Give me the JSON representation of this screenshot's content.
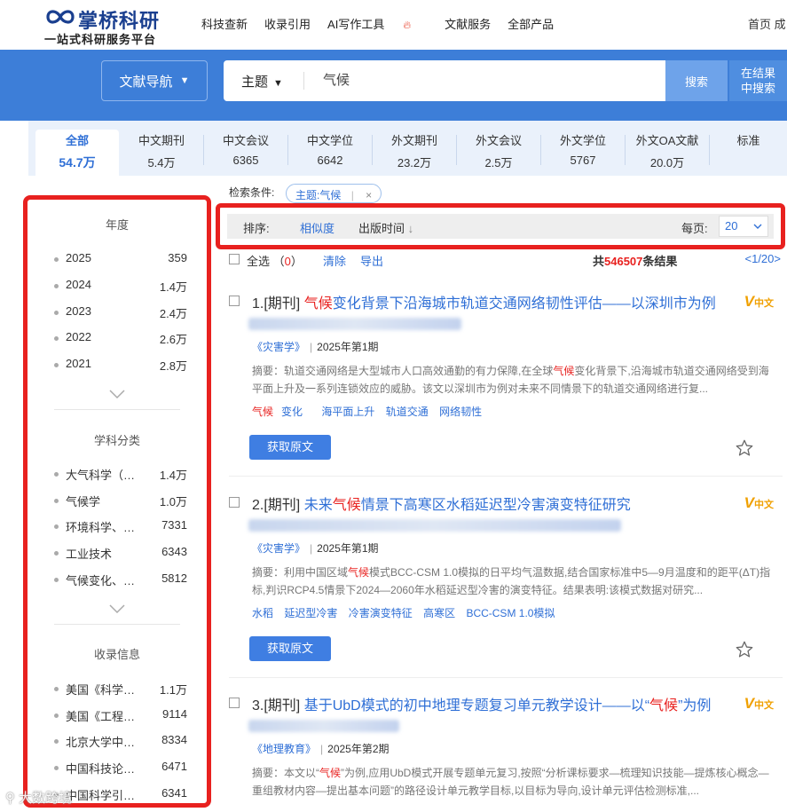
{
  "header": {
    "brand": "掌桥科研",
    "tagline": "一站式科研服务平台",
    "nav": [
      "科技查新",
      "收录引用",
      "AI写作工具",
      "文献服务",
      "全部产品"
    ],
    "right_link": "首页 成"
  },
  "search": {
    "nav_button": "文献导航",
    "field": "主题",
    "query": "气候",
    "search_button": "搜索",
    "in_results_line1": "在结果",
    "in_results_line2": "中搜索"
  },
  "tabs": [
    {
      "label": "全部",
      "count": "54.7万"
    },
    {
      "label": "中文期刊",
      "count": "5.4万"
    },
    {
      "label": "中文会议",
      "count": "6365"
    },
    {
      "label": "中文学位",
      "count": "6642"
    },
    {
      "label": "外文期刊",
      "count": "23.2万"
    },
    {
      "label": "外文会议",
      "count": "2.5万"
    },
    {
      "label": "外文学位",
      "count": "5767"
    },
    {
      "label": "外文OA文献",
      "count": "20.0万"
    },
    {
      "label": "标准",
      "count": ""
    }
  ],
  "sidebar": {
    "year": {
      "title": "年度",
      "items": [
        {
          "name": "2025",
          "count": "359"
        },
        {
          "name": "2024",
          "count": "1.4万"
        },
        {
          "name": "2023",
          "count": "2.4万"
        },
        {
          "name": "2022",
          "count": "2.6万"
        },
        {
          "name": "2021",
          "count": "2.8万"
        }
      ]
    },
    "subject": {
      "title": "学科分类",
      "items": [
        {
          "name": "大气科学（…",
          "count": "1.4万"
        },
        {
          "name": "气候学",
          "count": "1.0万"
        },
        {
          "name": "环境科学、…",
          "count": "7331"
        },
        {
          "name": "工业技术",
          "count": "6343"
        },
        {
          "name": "气候变化、…",
          "count": "5812"
        }
      ]
    },
    "indexing": {
      "title": "收录信息",
      "items": [
        {
          "name": "美国《科学…",
          "count": "1.1万"
        },
        {
          "name": "美国《工程…",
          "count": "9114"
        },
        {
          "name": "北京大学中…",
          "count": "8334"
        },
        {
          "name": "中国科技论…",
          "count": "6471"
        },
        {
          "name": "中国科学引…",
          "count": "6341"
        }
      ]
    }
  },
  "conditions": {
    "label": "检索条件:",
    "chip": "主题:气候",
    "chip_sep": "|",
    "close": "×"
  },
  "sortbar": {
    "label": "排序:",
    "relevance": "相似度",
    "pubtime": "出版时间",
    "arrow": "↓",
    "perpage_label": "每页:",
    "perpage": "20"
  },
  "selection": {
    "select_all": "全选",
    "selected_open": "（",
    "selected": "0",
    "selected_close": "）",
    "clear": "清除",
    "export": "导出",
    "total_prefix": "共",
    "total": "546507",
    "total_suffix": "条结果",
    "pages": "<1/20>"
  },
  "results": [
    {
      "idx": "1.[期刊]",
      "title_hl": "气候",
      "title_rest": "变化背景下沿海城市轨道交通网络韧性评估——以深圳市为例",
      "journal": "《灾害学》",
      "issue": "2025年第1期",
      "abstract_pre": "摘要：轨道交通网络是大型城市人口高效通勤的有力保障,在全球",
      "abstract_hl": "气候",
      "abstract_post": "变化背景下,沿海城市轨道交通网络受到海平面上升及一系列连锁效应的威胁。该文以深圳市为例对未来不同情景下的轨道交通网络进行复...",
      "keywords": [
        {
          "hl": "气候",
          "rest": "变化"
        },
        {
          "hl": "",
          "rest": "海平面上升"
        },
        {
          "hl": "",
          "rest": "轨道交通"
        },
        {
          "hl": "",
          "rest": "网络韧性"
        }
      ],
      "badge_v": "V",
      "badge": "中文",
      "get": "获取原文"
    },
    {
      "idx": "2.[期刊]",
      "title_pre": "未来",
      "title_hl": "气候",
      "title_rest": "情景下高寒区水稻延迟型冷害演变特征研究",
      "journal": "《灾害学》",
      "issue": "2025年第1期",
      "abstract_pre": "摘要：利用中国区域",
      "abstract_hl": "气候",
      "abstract_post": "模式BCC-CSM 1.0模拟的日平均气温数据,结合国家标准中5—9月温度和的距平(ΔT)指标,判识RCP4.5情景下2024—2060年水稻延迟型冷害的演变特征。结果表明:该模式数据对研究...",
      "keywords": [
        {
          "hl": "",
          "rest": "水稻"
        },
        {
          "hl": "",
          "rest": "延迟型冷害"
        },
        {
          "hl": "",
          "rest": "冷害演变特征"
        },
        {
          "hl": "",
          "rest": "高寒区"
        },
        {
          "hl": "",
          "rest": "BCC-CSM 1.0模拟"
        }
      ],
      "badge_v": "V",
      "badge": "中文",
      "get": "获取原文"
    },
    {
      "idx": "3.[期刊]",
      "title_pre": "基于UbD模式的初中地理专题复习单元教学设计——以“",
      "title_hl": "气候",
      "title_rest": "”为例",
      "journal": "《地理教育》",
      "issue": "2025年第2期",
      "abstract_pre": "摘要：本文以“",
      "abstract_hl": "气候",
      "abstract_post": "”为例,应用UbD模式开展专题单元复习,按照“分析课标要求—梳理知识技能—提炼核心概念—重组教材内容—提出基本问题”的路径设计单元教学目标,以目标为导向,设计单元评估检测标准,...",
      "badge_v": "V",
      "badge": "中文"
    }
  ],
  "watermark": "大数跨境"
}
